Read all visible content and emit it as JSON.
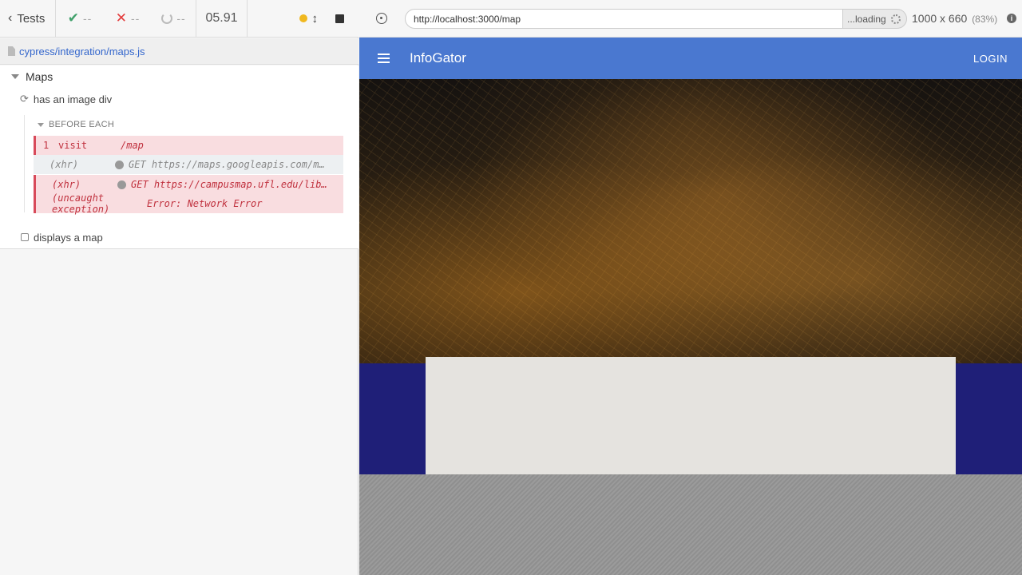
{
  "reporter": {
    "back_label": "Tests",
    "passed": "--",
    "failed": "--",
    "pending": "--",
    "duration": "05.91",
    "spec_path": "cypress/integration/maps.js",
    "suite_title": "Maps",
    "tests": [
      {
        "title": "has an image div",
        "state": "running"
      },
      {
        "title": "displays a map",
        "state": "pending"
      }
    ],
    "hook_title": "BEFORE EACH",
    "commands": [
      {
        "num": "1",
        "name": "visit",
        "message": "/map",
        "style": "error"
      },
      {
        "num": "",
        "name": "(xhr)",
        "message": "GET https://maps.googleapis.com/maps/api/js",
        "style": "plain"
      },
      {
        "num": "",
        "name": "(xhr)",
        "message": "GET https://campusmap.ufl.edu/library/cmapjson/",
        "style": "error"
      },
      {
        "num": "",
        "name": "(uncaught exception)",
        "message": "Error: Network Error",
        "style": "error"
      }
    ]
  },
  "aut": {
    "url": "http://localhost:3000/map",
    "loading_label": "...loading",
    "viewport_size": "1000 x 660",
    "viewport_scale": "(83%)",
    "app": {
      "title": "InfoGator",
      "login_label": "LOGIN"
    },
    "colors": {
      "app_bar": "#4a78d0",
      "band": "#1f1f78",
      "map_placeholder": "#e5e3df"
    }
  }
}
